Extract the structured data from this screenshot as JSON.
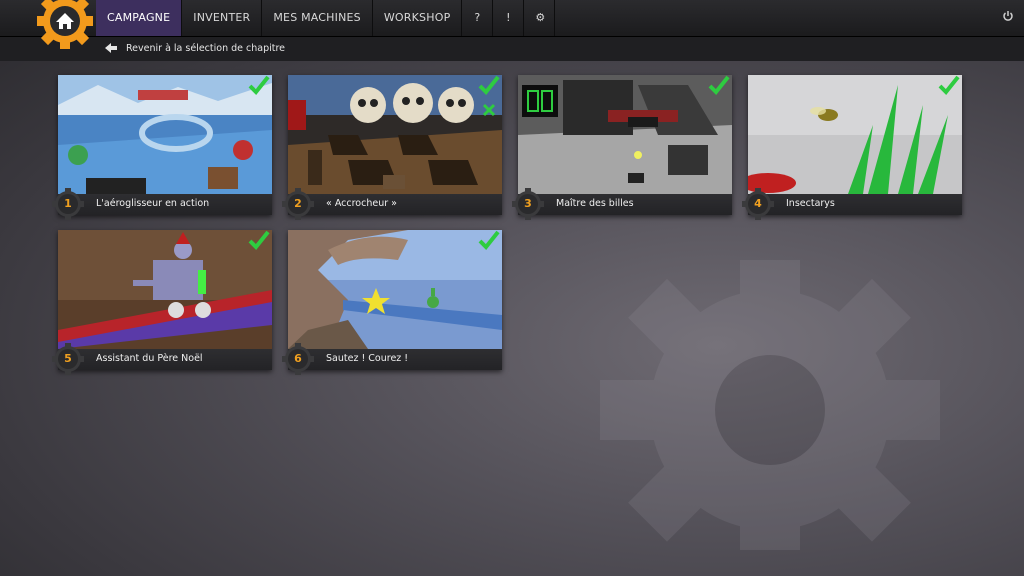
{
  "nav": {
    "items": [
      {
        "label": "CAMPAGNE",
        "active": true
      },
      {
        "label": "INVENTER",
        "active": false
      },
      {
        "label": "MES MACHINES",
        "active": false
      },
      {
        "label": "WORKSHOP",
        "active": false
      },
      {
        "label": "?",
        "active": false
      },
      {
        "label": "!",
        "active": false
      },
      {
        "label": "⚙",
        "active": false
      }
    ],
    "power_icon": "power-icon",
    "home_icon": "home-icon"
  },
  "subbar": {
    "back_label": "Revenir à la sélection de chapitre",
    "back_icon": "arrow-left-icon"
  },
  "colors": {
    "accent": "#f29a1c",
    "nav_active": "#3d2f5e",
    "check": "#2ecc40",
    "number": "#f0a020"
  },
  "levels": [
    {
      "number": "1",
      "title": "L'aéroglisseur en action",
      "completed": true
    },
    {
      "number": "2",
      "title": "« Accrocheur »",
      "completed": true
    },
    {
      "number": "3",
      "title": "Maître des billes",
      "completed": true
    },
    {
      "number": "4",
      "title": "Insectarys",
      "completed": true
    },
    {
      "number": "5",
      "title": "Assistant du Père Noël",
      "completed": true
    },
    {
      "number": "6",
      "title": "Sautez ! Courez !",
      "completed": true
    }
  ]
}
